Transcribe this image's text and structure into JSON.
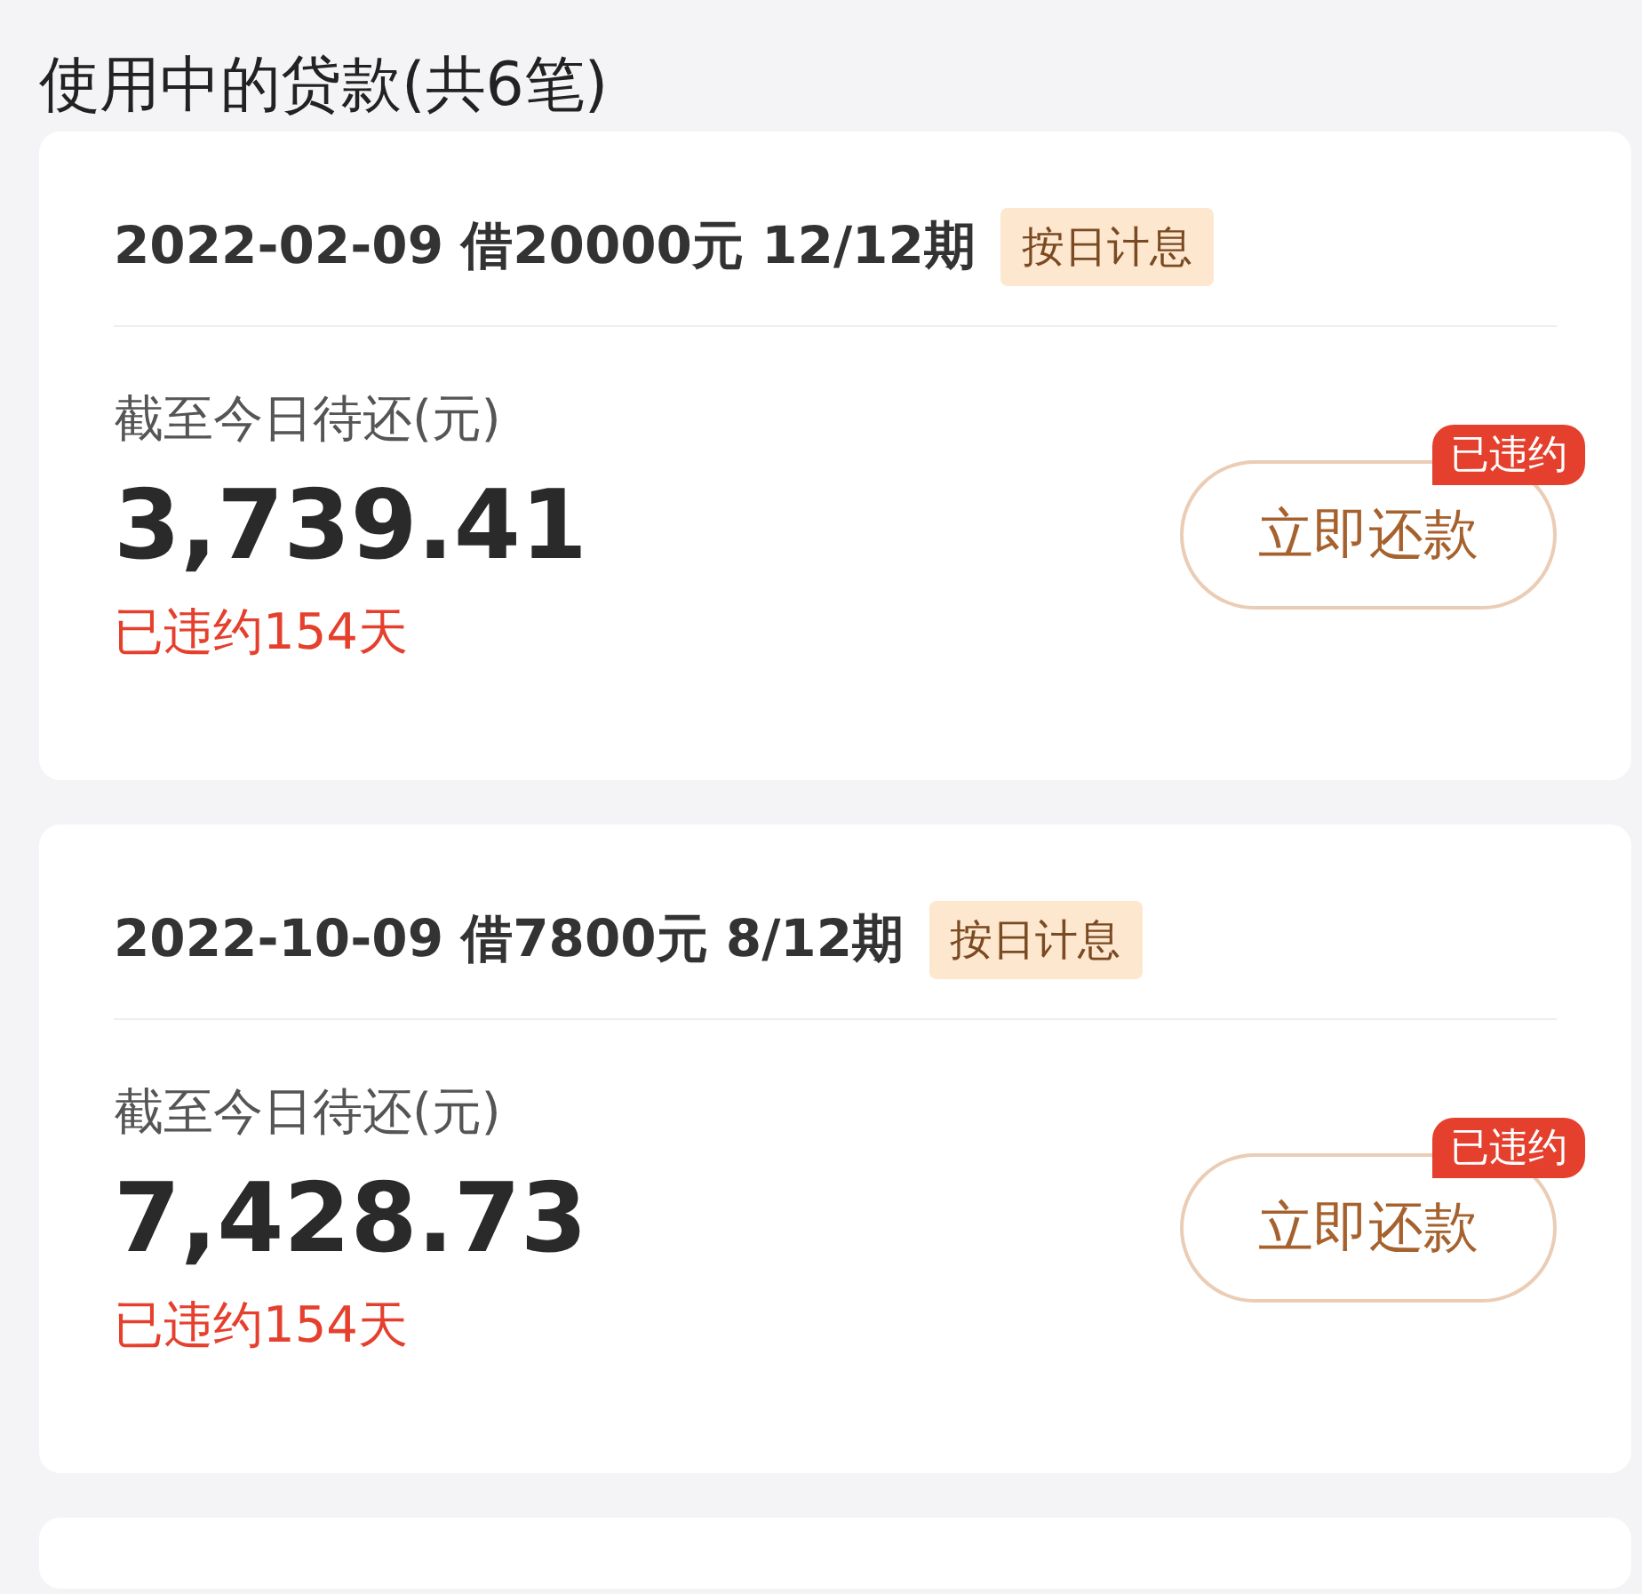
{
  "title": "使用中的贷款(共6笔)",
  "loans": [
    {
      "header": "2022-02-09 借20000元 12/12期",
      "tag": "按日计息",
      "due_label": "截至今日待还(元)",
      "amount": "3,739.41",
      "status": "已违约154天",
      "badge": "已违约",
      "button": "立即还款"
    },
    {
      "header": "2022-10-09 借7800元 8/12期",
      "tag": "按日计息",
      "due_label": "截至今日待还(元)",
      "amount": "7,428.73",
      "status": "已违约154天",
      "badge": "已违约",
      "button": "立即还款"
    }
  ]
}
